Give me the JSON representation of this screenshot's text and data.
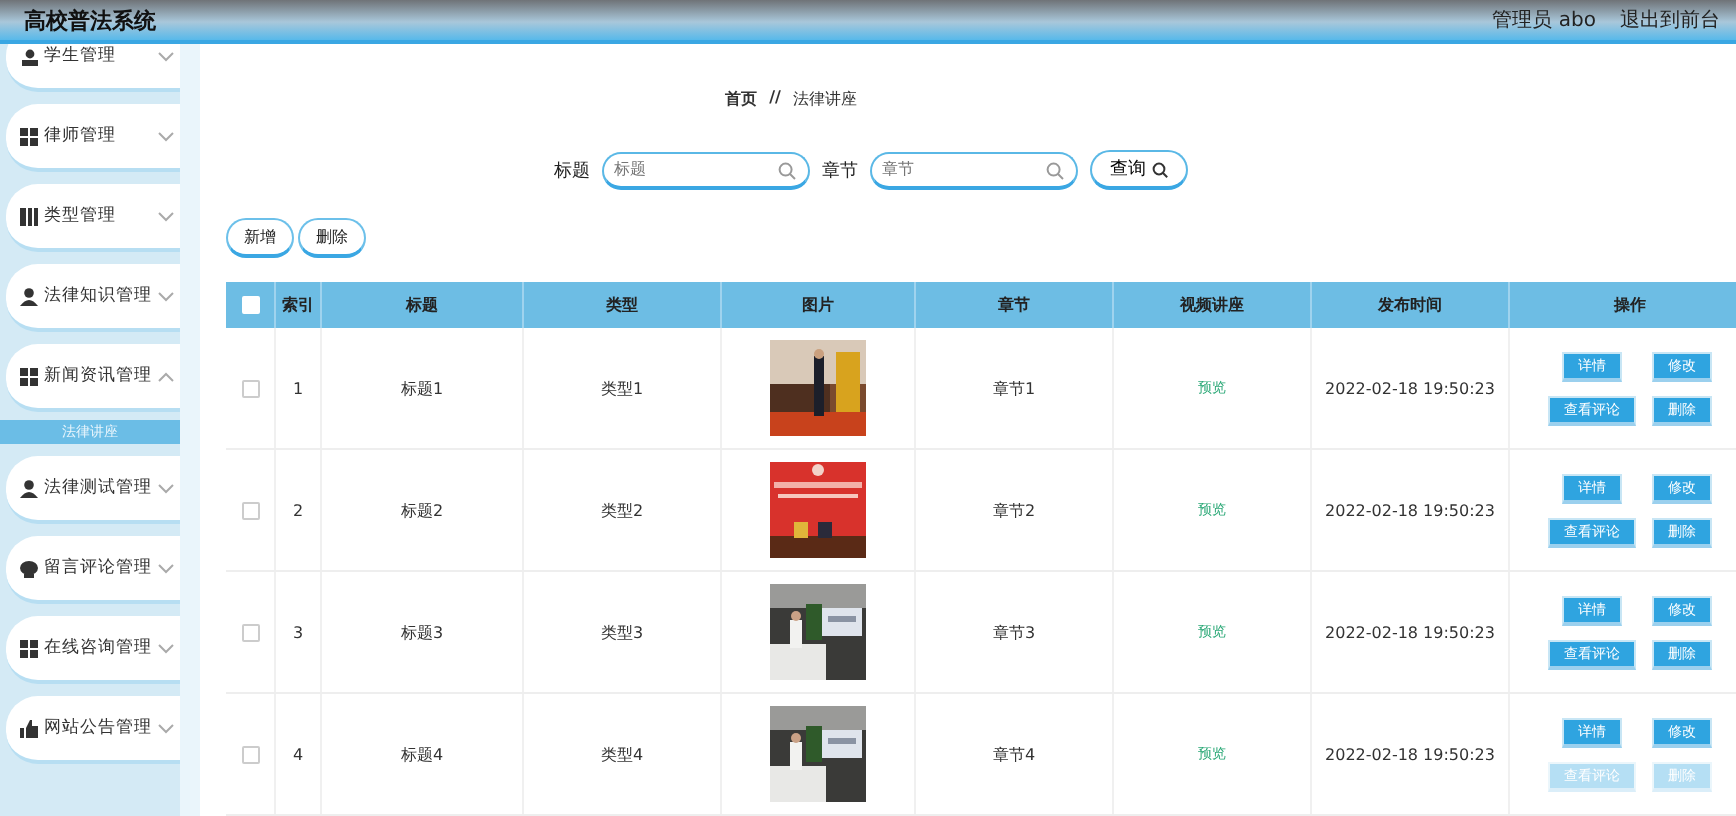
{
  "header": {
    "title": "高校普法系统",
    "user": "管理员 abo",
    "exit": "退出到前台"
  },
  "sidebar": {
    "items": [
      {
        "label": "学生管理",
        "expanded": false
      },
      {
        "label": "律师管理",
        "expanded": false
      },
      {
        "label": "类型管理",
        "expanded": false
      },
      {
        "label": "法律知识管理",
        "expanded": false
      },
      {
        "label": "新闻资讯管理",
        "expanded": true,
        "children": [
          {
            "label": "法律讲座",
            "selected": true
          }
        ]
      },
      {
        "label": "法律测试管理",
        "expanded": false
      },
      {
        "label": "留言评论管理",
        "expanded": false
      },
      {
        "label": "在线咨询管理",
        "expanded": false
      },
      {
        "label": "网站公告管理",
        "expanded": false
      }
    ]
  },
  "breadcrumb": [
    "首页",
    "//",
    "法律讲座"
  ],
  "search": {
    "fields": [
      {
        "label": "标题",
        "placeholder": "标题"
      },
      {
        "label": "章节",
        "placeholder": "章节"
      }
    ],
    "button": "查询"
  },
  "toolbar": [
    "新增",
    "删除"
  ],
  "table": {
    "select_all": false,
    "columns": [
      "索引",
      "标题",
      "类型",
      "图片",
      "章节",
      "视频讲座",
      "发布时间",
      "操作"
    ],
    "rows": [
      {
        "checked": false,
        "index": "1",
        "title": "标题1",
        "type": "类型1",
        "chapter": "章节1",
        "video": "预览",
        "time": "2022-02-18 19:50:23",
        "actions": [
          "详情",
          "修改",
          "查看评论",
          "删除"
        ]
      },
      {
        "checked": false,
        "index": "2",
        "title": "标题2",
        "type": "类型2",
        "chapter": "章节2",
        "video": "预览",
        "time": "2022-02-18 19:50:23",
        "actions": [
          "详情",
          "修改",
          "查看评论",
          "删除"
        ]
      },
      {
        "checked": false,
        "index": "3",
        "title": "标题3",
        "type": "类型3",
        "chapter": "章节3",
        "video": "预览",
        "time": "2022-02-18 19:50:23",
        "actions": [
          "详情",
          "修改",
          "查看评论",
          "删除"
        ]
      },
      {
        "checked": false,
        "index": "4",
        "title": "标题4",
        "type": "类型4",
        "chapter": "章节4",
        "video": "预览",
        "time": "2022-02-18 19:50:23",
        "actions": [
          "详情",
          "修改",
          "查看评论",
          "删除"
        ]
      }
    ]
  }
}
